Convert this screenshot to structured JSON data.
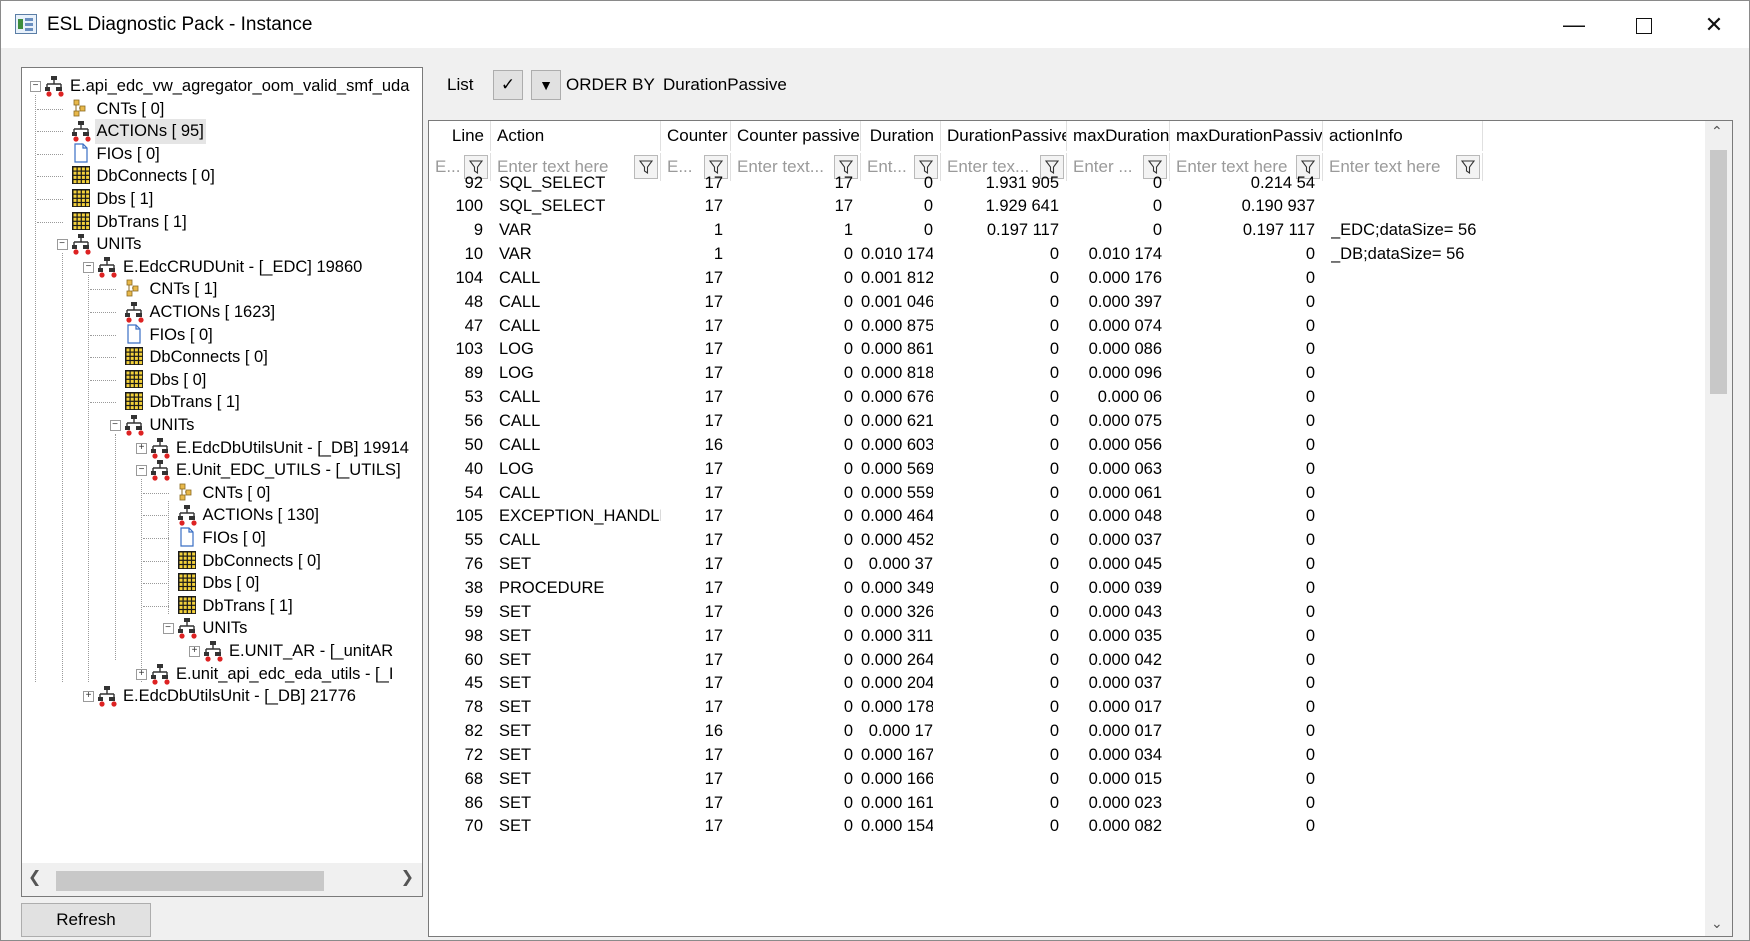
{
  "window": {
    "title": "ESL Diagnostic Pack - Instance",
    "min": "—",
    "close": "✕"
  },
  "tree": {
    "nodes": [
      {
        "label": "E.api_edc_vw_agregator_oom_valid_smf_uda",
        "icon": "unit-icon",
        "level": 0,
        "exp": "−"
      },
      {
        "label": "CNTs [ 0]",
        "icon": "counter-icon",
        "level": 1
      },
      {
        "label": "ACTIONs [ 95]",
        "icon": "actions-icon",
        "level": 1,
        "selected": true
      },
      {
        "label": "FIOs [ 0]",
        "icon": "file-icon",
        "level": 1
      },
      {
        "label": "DbConnects [ 0]",
        "icon": "table-icon",
        "level": 1
      },
      {
        "label": "Dbs [ 1]",
        "icon": "table-icon",
        "level": 1
      },
      {
        "label": "DbTrans [ 1]",
        "icon": "table-icon",
        "level": 1
      },
      {
        "label": "UNITs",
        "icon": "unit-icon",
        "level": 1,
        "exp": "−"
      },
      {
        "label": "E.EdcCRUDUnit - [_EDC] 19860",
        "icon": "unit-icon",
        "level": 2,
        "exp": "−"
      },
      {
        "label": "CNTs [ 1]",
        "icon": "counter-icon",
        "level": 3
      },
      {
        "label": "ACTIONs [ 1623]",
        "icon": "actions-icon",
        "level": 3
      },
      {
        "label": "FIOs [ 0]",
        "icon": "file-icon",
        "level": 3
      },
      {
        "label": "DbConnects [ 0]",
        "icon": "table-icon",
        "level": 3
      },
      {
        "label": "Dbs [ 0]",
        "icon": "table-icon",
        "level": 3
      },
      {
        "label": "DbTrans [ 1]",
        "icon": "table-icon",
        "level": 3
      },
      {
        "label": "UNITs",
        "icon": "unit-icon",
        "level": 3,
        "exp": "−"
      },
      {
        "label": "E.EdcDbUtilsUnit - [_DB] 19914",
        "icon": "unit-icon",
        "level": 4,
        "exp": "+"
      },
      {
        "label": "E.Unit_EDC_UTILS - [_UTILS]",
        "icon": "unit-icon",
        "level": 4,
        "exp": "−"
      },
      {
        "label": "CNTs [ 0]",
        "icon": "counter-icon",
        "level": 5
      },
      {
        "label": "ACTIONs [ 130]",
        "icon": "actions-icon",
        "level": 5
      },
      {
        "label": "FIOs [ 0]",
        "icon": "file-icon",
        "level": 5
      },
      {
        "label": "DbConnects [ 0]",
        "icon": "table-icon",
        "level": 5
      },
      {
        "label": "Dbs [ 0]",
        "icon": "table-icon",
        "level": 5
      },
      {
        "label": "DbTrans [ 1]",
        "icon": "table-icon",
        "level": 5
      },
      {
        "label": "UNITs",
        "icon": "unit-icon",
        "level": 5,
        "exp": "−"
      },
      {
        "label": "E.UNIT_AR - [_unitAR",
        "icon": "unit-icon",
        "level": 6,
        "exp": "+"
      },
      {
        "label": "E.unit_api_edc_eda_utils - [_I",
        "icon": "unit-icon",
        "level": 4,
        "exp": "+"
      },
      {
        "label": "E.EdcDbUtilsUnit - [_DB] 21776",
        "icon": "unit-icon",
        "level": 2,
        "exp": "+"
      }
    ]
  },
  "refresh_label": "Refresh",
  "toolbar": {
    "list_label": "List",
    "check": "✓",
    "dropdown": "▼",
    "order_by_label": "ORDER BY",
    "order_by_value": "DurationPassive"
  },
  "grid": {
    "columns": [
      {
        "header": "Line",
        "placeholder": "E..."
      },
      {
        "header": "Action",
        "placeholder": "Enter text here"
      },
      {
        "header": "Counter",
        "placeholder": "E..."
      },
      {
        "header": "Counter passive",
        "placeholder": "Enter text..."
      },
      {
        "header": "Duration",
        "placeholder": "Ent..."
      },
      {
        "header": "DurationPassive",
        "placeholder": "Enter tex..."
      },
      {
        "header": "maxDuration",
        "placeholder": "Enter ..."
      },
      {
        "header": "maxDurationPassive",
        "placeholder": "Enter text here"
      },
      {
        "header": "actionInfo",
        "placeholder": "Enter text here"
      }
    ],
    "rows": [
      [
        "92",
        "SQL_SELECT",
        "17",
        "17",
        "0",
        "1.931 905",
        "0",
        "0.214 54",
        ""
      ],
      [
        "100",
        "SQL_SELECT",
        "17",
        "17",
        "0",
        "1.929 641",
        "0",
        "0.190 937",
        ""
      ],
      [
        "9",
        "VAR",
        "1",
        "1",
        "0",
        "0.197 117",
        "0",
        "0.197 117",
        "_EDC;dataSize= 56"
      ],
      [
        "10",
        "VAR",
        "1",
        "0",
        "0.010 174",
        "0",
        "0.010 174",
        "0",
        "_DB;dataSize= 56"
      ],
      [
        "104",
        "CALL",
        "17",
        "0",
        "0.001 812",
        "0",
        "0.000 176",
        "0",
        ""
      ],
      [
        "48",
        "CALL",
        "17",
        "0",
        "0.001 046",
        "0",
        "0.000 397",
        "0",
        ""
      ],
      [
        "47",
        "CALL",
        "17",
        "0",
        "0.000 875",
        "0",
        "0.000 074",
        "0",
        ""
      ],
      [
        "103",
        "LOG",
        "17",
        "0",
        "0.000 861",
        "0",
        "0.000 086",
        "0",
        ""
      ],
      [
        "89",
        "LOG",
        "17",
        "0",
        "0.000 818",
        "0",
        "0.000 096",
        "0",
        ""
      ],
      [
        "53",
        "CALL",
        "17",
        "0",
        "0.000 676",
        "0",
        "0.000 06",
        "0",
        ""
      ],
      [
        "56",
        "CALL",
        "17",
        "0",
        "0.000 621",
        "0",
        "0.000 075",
        "0",
        ""
      ],
      [
        "50",
        "CALL",
        "16",
        "0",
        "0.000 603",
        "0",
        "0.000 056",
        "0",
        ""
      ],
      [
        "40",
        "LOG",
        "17",
        "0",
        "0.000 569",
        "0",
        "0.000 063",
        "0",
        ""
      ],
      [
        "54",
        "CALL",
        "17",
        "0",
        "0.000 559",
        "0",
        "0.000 061",
        "0",
        ""
      ],
      [
        "105",
        "EXCEPTION_HANDLER",
        "17",
        "0",
        "0.000 464",
        "0",
        "0.000 048",
        "0",
        ""
      ],
      [
        "55",
        "CALL",
        "17",
        "0",
        "0.000 452",
        "0",
        "0.000 037",
        "0",
        ""
      ],
      [
        "76",
        "SET",
        "17",
        "0",
        "0.000 37",
        "0",
        "0.000 045",
        "0",
        ""
      ],
      [
        "38",
        "PROCEDURE",
        "17",
        "0",
        "0.000 349",
        "0",
        "0.000 039",
        "0",
        ""
      ],
      [
        "59",
        "SET",
        "17",
        "0",
        "0.000 326",
        "0",
        "0.000 043",
        "0",
        ""
      ],
      [
        "98",
        "SET",
        "17",
        "0",
        "0.000 311",
        "0",
        "0.000 035",
        "0",
        ""
      ],
      [
        "60",
        "SET",
        "17",
        "0",
        "0.000 264",
        "0",
        "0.000 042",
        "0",
        ""
      ],
      [
        "45",
        "SET",
        "17",
        "0",
        "0.000 204",
        "0",
        "0.000 037",
        "0",
        ""
      ],
      [
        "78",
        "SET",
        "17",
        "0",
        "0.000 178",
        "0",
        "0.000 017",
        "0",
        ""
      ],
      [
        "82",
        "SET",
        "16",
        "0",
        "0.000 17",
        "0",
        "0.000 017",
        "0",
        ""
      ],
      [
        "72",
        "SET",
        "17",
        "0",
        "0.000 167",
        "0",
        "0.000 034",
        "0",
        ""
      ],
      [
        "68",
        "SET",
        "17",
        "0",
        "0.000 166",
        "0",
        "0.000 015",
        "0",
        ""
      ],
      [
        "86",
        "SET",
        "17",
        "0",
        "0.000 161",
        "0",
        "0.000 023",
        "0",
        ""
      ],
      [
        "70",
        "SET",
        "17",
        "0",
        "0.000 154",
        "0",
        "0.000 082",
        "0",
        ""
      ]
    ]
  }
}
